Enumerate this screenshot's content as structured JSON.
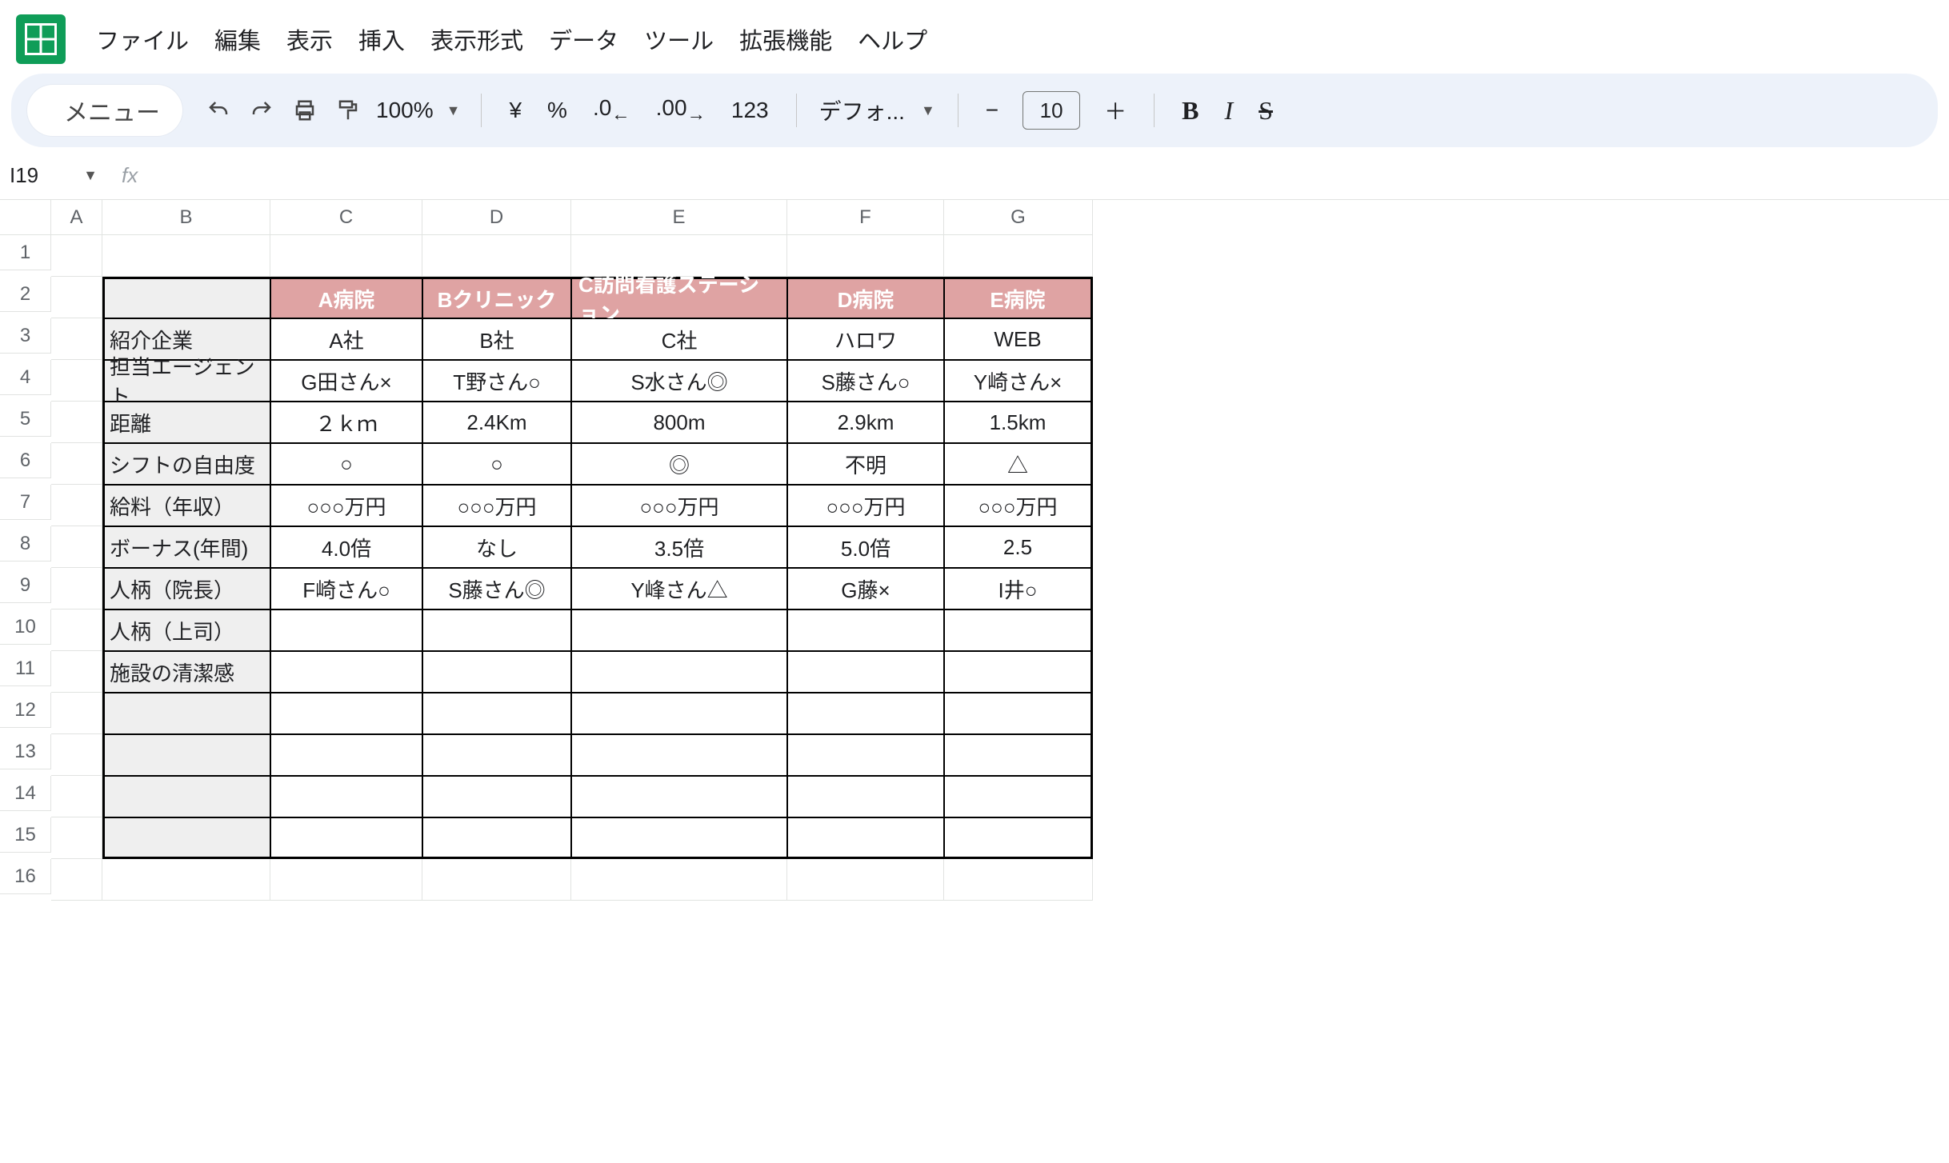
{
  "menus": {
    "file": "ファイル",
    "edit": "編集",
    "view": "表示",
    "insert": "挿入",
    "format": "表示形式",
    "data": "データ",
    "tools": "ツール",
    "extensions": "拡張機能",
    "help": "ヘルプ"
  },
  "toolbar": {
    "menu_label": "メニュー",
    "zoom": "100%",
    "currency": "¥",
    "percent": "%",
    "dec_dec": ".0",
    "dec_inc": ".00",
    "nums": "123",
    "font_name": "デフォ...",
    "font_size": "10",
    "bold": "B",
    "italic": "I",
    "strike": "S"
  },
  "name_box": "I19",
  "columns": [
    "A",
    "B",
    "C",
    "D",
    "E",
    "F",
    "G"
  ],
  "rows": [
    "1",
    "2",
    "3",
    "4",
    "5",
    "6",
    "7",
    "8",
    "9",
    "10",
    "11",
    "12",
    "13",
    "14",
    "15",
    "16"
  ],
  "table": {
    "header_labels": [
      "",
      "A病院",
      "Bクリニック",
      "C訪問看護ステーション",
      "D病院",
      "E病院"
    ],
    "row_labels": [
      "紹介企業",
      "担当エージェント",
      "距離",
      "シフトの自由度",
      "給料（年収）",
      "ボーナス(年間)",
      "人柄（院長）",
      "人柄（上司）",
      "施設の清潔感"
    ],
    "data": [
      [
        "A社",
        "B社",
        "C社",
        "ハロワ",
        "WEB"
      ],
      [
        "G田さん×",
        "T野さん○",
        "S水さん◎",
        "S藤さん○",
        "Y崎さん×"
      ],
      [
        "２ｋｍ",
        "2.4Km",
        "800m",
        "2.9km",
        "1.5km"
      ],
      [
        "○",
        "○",
        "◎",
        "不明",
        "△"
      ],
      [
        "○○○万円",
        "○○○万円",
        "○○○万円",
        "○○○万円",
        "○○○万円"
      ],
      [
        "4.0倍",
        "なし",
        "3.5倍",
        "5.0倍",
        "2.5"
      ],
      [
        "F崎さん○",
        "S藤さん◎",
        "Y峰さん△",
        "G藤×",
        "I井○"
      ],
      [
        "",
        "",
        "",
        "",
        ""
      ],
      [
        "",
        "",
        "",
        "",
        ""
      ]
    ],
    "blank_tail_rows": 4
  }
}
